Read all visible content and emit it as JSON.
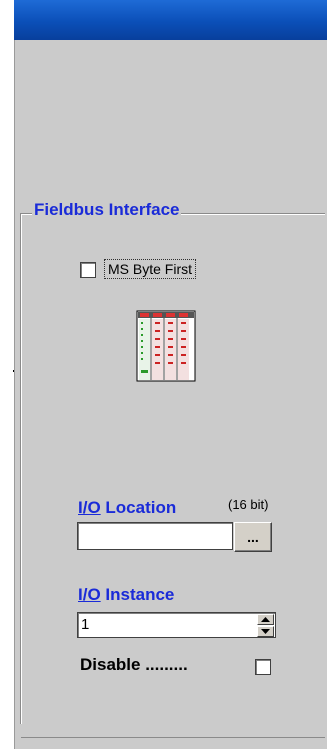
{
  "group": {
    "title": "Fieldbus Interface"
  },
  "ms_byte_first": {
    "label": "MS Byte First",
    "checked": false
  },
  "io_location": {
    "label_prefix": "I/O",
    "label_rest": " Location",
    "note": "(16 bit)",
    "value": "",
    "browse_label": "..."
  },
  "io_instance": {
    "label_prefix": "I/O",
    "label_rest": " Instance",
    "value": "1"
  },
  "disable": {
    "label": "Disable .........",
    "checked": false
  },
  "icons": {
    "device": "fieldbus-device-icon"
  },
  "colors": {
    "accent_text": "#1a2bd8",
    "titlebar": "#0b4fb8",
    "panel_bg": "#cbcbcb"
  }
}
